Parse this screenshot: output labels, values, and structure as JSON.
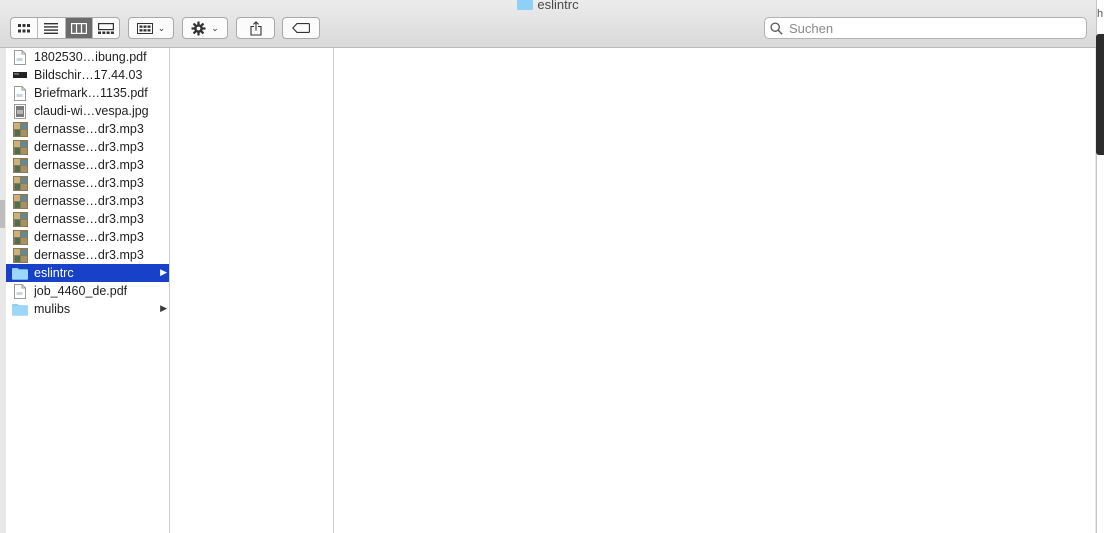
{
  "window": {
    "title": "eslintrc",
    "edge_fragment": "h"
  },
  "toolbar": {
    "view_modes": [
      {
        "name": "icon-view",
        "icon": "grid-icon",
        "active": false
      },
      {
        "name": "list-view",
        "icon": "list-icon",
        "active": false
      },
      {
        "name": "column-view",
        "icon": "columns-icon",
        "active": true
      },
      {
        "name": "gallery-view",
        "icon": "gallery-icon",
        "active": false
      }
    ],
    "group_button_icon": "group-grid-icon",
    "action_button_icon": "gear-icon",
    "share_button_icon": "share-icon",
    "tag_button_icon": "tag-icon"
  },
  "search": {
    "placeholder": "Suchen",
    "value": ""
  },
  "files": [
    {
      "label": "1802530…ibung.pdf",
      "icon": "pdf-file-icon",
      "folder": false,
      "selected": false
    },
    {
      "label": "Bildschir…17.44.03",
      "icon": "screenshot-file-icon",
      "folder": false,
      "selected": false
    },
    {
      "label": "Briefmark…1135.pdf",
      "icon": "pdf-file-icon",
      "folder": false,
      "selected": false
    },
    {
      "label": "claudi-wi…vespa.jpg",
      "icon": "jpg-file-icon",
      "folder": false,
      "selected": false
    },
    {
      "label": "dernasse…dr3.mp3",
      "icon": "mp3-file-icon",
      "folder": false,
      "selected": false
    },
    {
      "label": "dernasse…dr3.mp3",
      "icon": "mp3-file-icon",
      "folder": false,
      "selected": false
    },
    {
      "label": "dernasse…dr3.mp3",
      "icon": "mp3-file-icon",
      "folder": false,
      "selected": false
    },
    {
      "label": "dernasse…dr3.mp3",
      "icon": "mp3-file-icon",
      "folder": false,
      "selected": false
    },
    {
      "label": "dernasse…dr3.mp3",
      "icon": "mp3-file-icon",
      "folder": false,
      "selected": false
    },
    {
      "label": "dernasse…dr3.mp3",
      "icon": "mp3-file-icon",
      "folder": false,
      "selected": false
    },
    {
      "label": "dernasse…dr3.mp3",
      "icon": "mp3-file-icon",
      "folder": false,
      "selected": false
    },
    {
      "label": "dernasse…dr3.mp3",
      "icon": "mp3-file-icon",
      "folder": false,
      "selected": false
    },
    {
      "label": "eslintrc",
      "icon": "folder-icon",
      "folder": true,
      "selected": true
    },
    {
      "label": "job_4460_de.pdf",
      "icon": "pdf-file-icon",
      "folder": false,
      "selected": false
    },
    {
      "label": "mulibs",
      "icon": "folder-icon",
      "folder": true,
      "selected": false
    }
  ],
  "colors": {
    "selection": "#1641c8",
    "folder": "#8fd0f7"
  }
}
